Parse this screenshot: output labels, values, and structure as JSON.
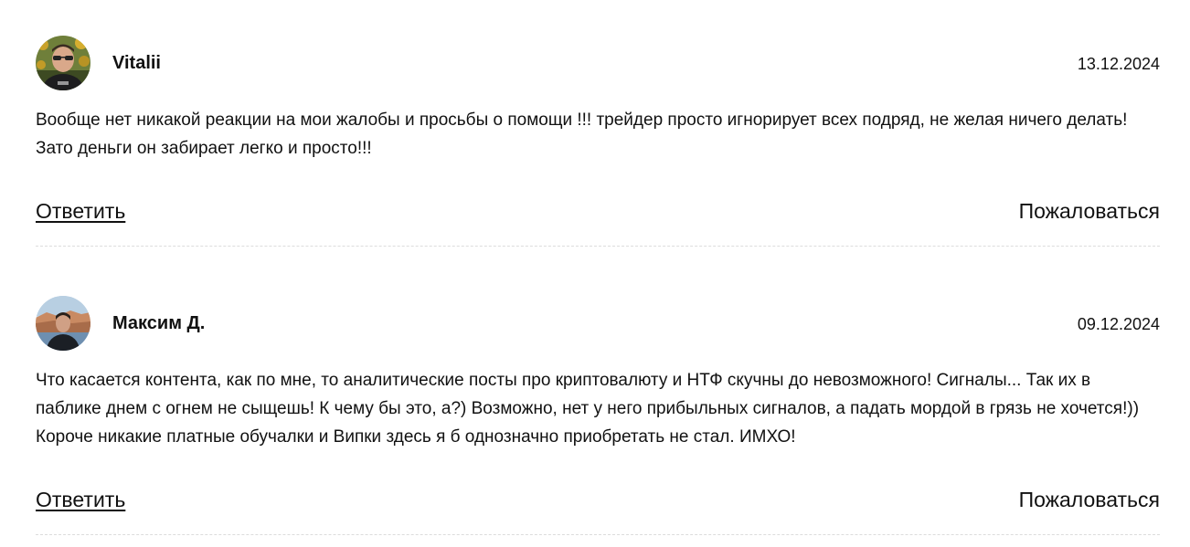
{
  "comments": [
    {
      "author": "Vitalii",
      "date": "13.12.2024",
      "text": "Вообще нет никакой реакции на мои жалобы и просьбы о помощи !!! трейдер просто игнорирует всех подряд, не желая ничего делать! Зато деньги он забирает легко и просто!!!",
      "reply_label": "Ответить",
      "report_label": "Пожаловаться",
      "avatar_icon": "user-photo-avatar"
    },
    {
      "author": "Максим Д.",
      "date": "09.12.2024",
      "text": "Что касается контента, как по мне, то аналитические посты про криптовалюту и НТФ скучны до невозможного! Сигналы... Так их в паблике днем с огнем не сыщешь! К чему бы это, а?) Возможно, нет у него прибыльных сигналов, а падать мордой в грязь не хочется!)) Короче никакие платные обучалки и Випки здесь я б однозначно приобретать не стал. ИМХО!",
      "reply_label": "Ответить",
      "report_label": "Пожаловаться",
      "avatar_icon": "user-photo-avatar"
    }
  ],
  "colors": {
    "text": "#111111",
    "divider": "#dcdcdc",
    "background": "#ffffff"
  }
}
